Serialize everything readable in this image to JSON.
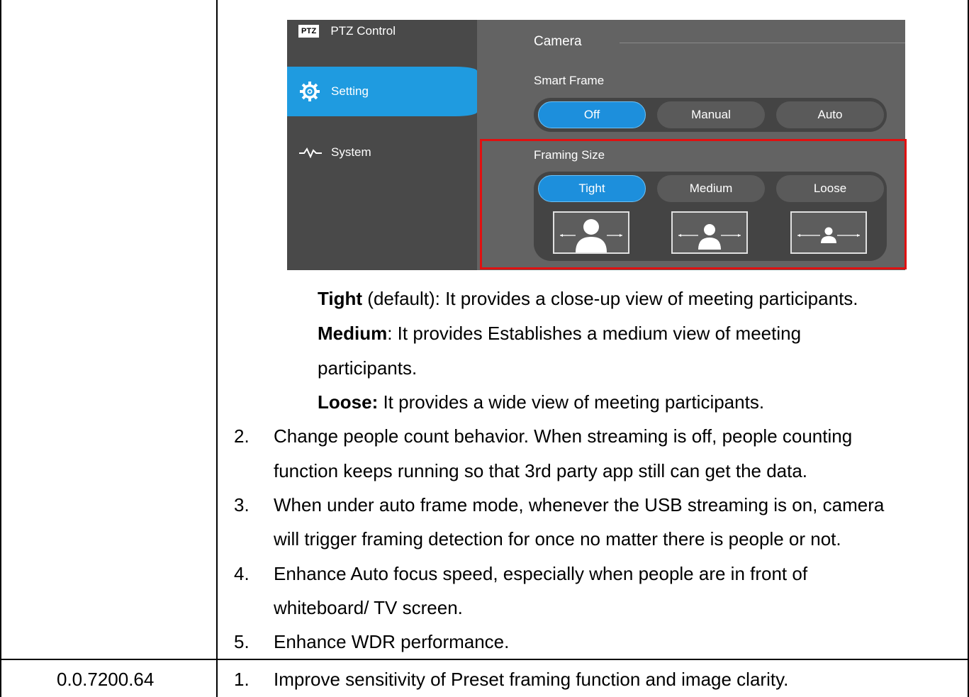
{
  "ui": {
    "sidebar": {
      "ptz_badge": "PTZ",
      "ptz_label": "PTZ Control",
      "setting_label": "Setting",
      "system_label": "System"
    },
    "camera_title": "Camera",
    "smart_frame": {
      "label": "Smart Frame",
      "options": [
        "Off",
        "Manual",
        "Auto"
      ],
      "selected": "Off"
    },
    "framing_size": {
      "label": "Framing Size",
      "options": [
        "Tight",
        "Medium",
        "Loose"
      ],
      "selected": "Tight"
    },
    "highlight_color": "#e01010",
    "accent_color": "#1d8fdc"
  },
  "descriptions": {
    "tight_term": "Tight",
    "tight_text": " (default): It provides a close-up view of meeting participants.",
    "medium_term": "Medium",
    "medium_text_1": ": It provides Establishes a medium view of meeting",
    "medium_text_2": "participants.",
    "loose_term": "Loose:",
    "loose_text": " It provides a wide view of meeting participants."
  },
  "items": [
    {
      "num": "2.",
      "lines": [
        "Change people count behavior. When streaming is off, people counting",
        "function keeps running so that 3rd party app still can get the data."
      ]
    },
    {
      "num": "3.",
      "lines": [
        "When under auto frame mode, whenever the USB streaming is on, camera",
        "will trigger framing detection for once no matter there is people or not."
      ]
    },
    {
      "num": "4.",
      "lines": [
        "Enhance Auto focus speed, especially when people are in front of",
        "whiteboard/ TV screen."
      ]
    },
    {
      "num": "5.",
      "lines": [
        "Enhance WDR performance."
      ]
    }
  ],
  "next_row": {
    "version": "0.0.7200.64",
    "num": "1.",
    "text": "Improve sensitivity of Preset framing function and image clarity."
  }
}
